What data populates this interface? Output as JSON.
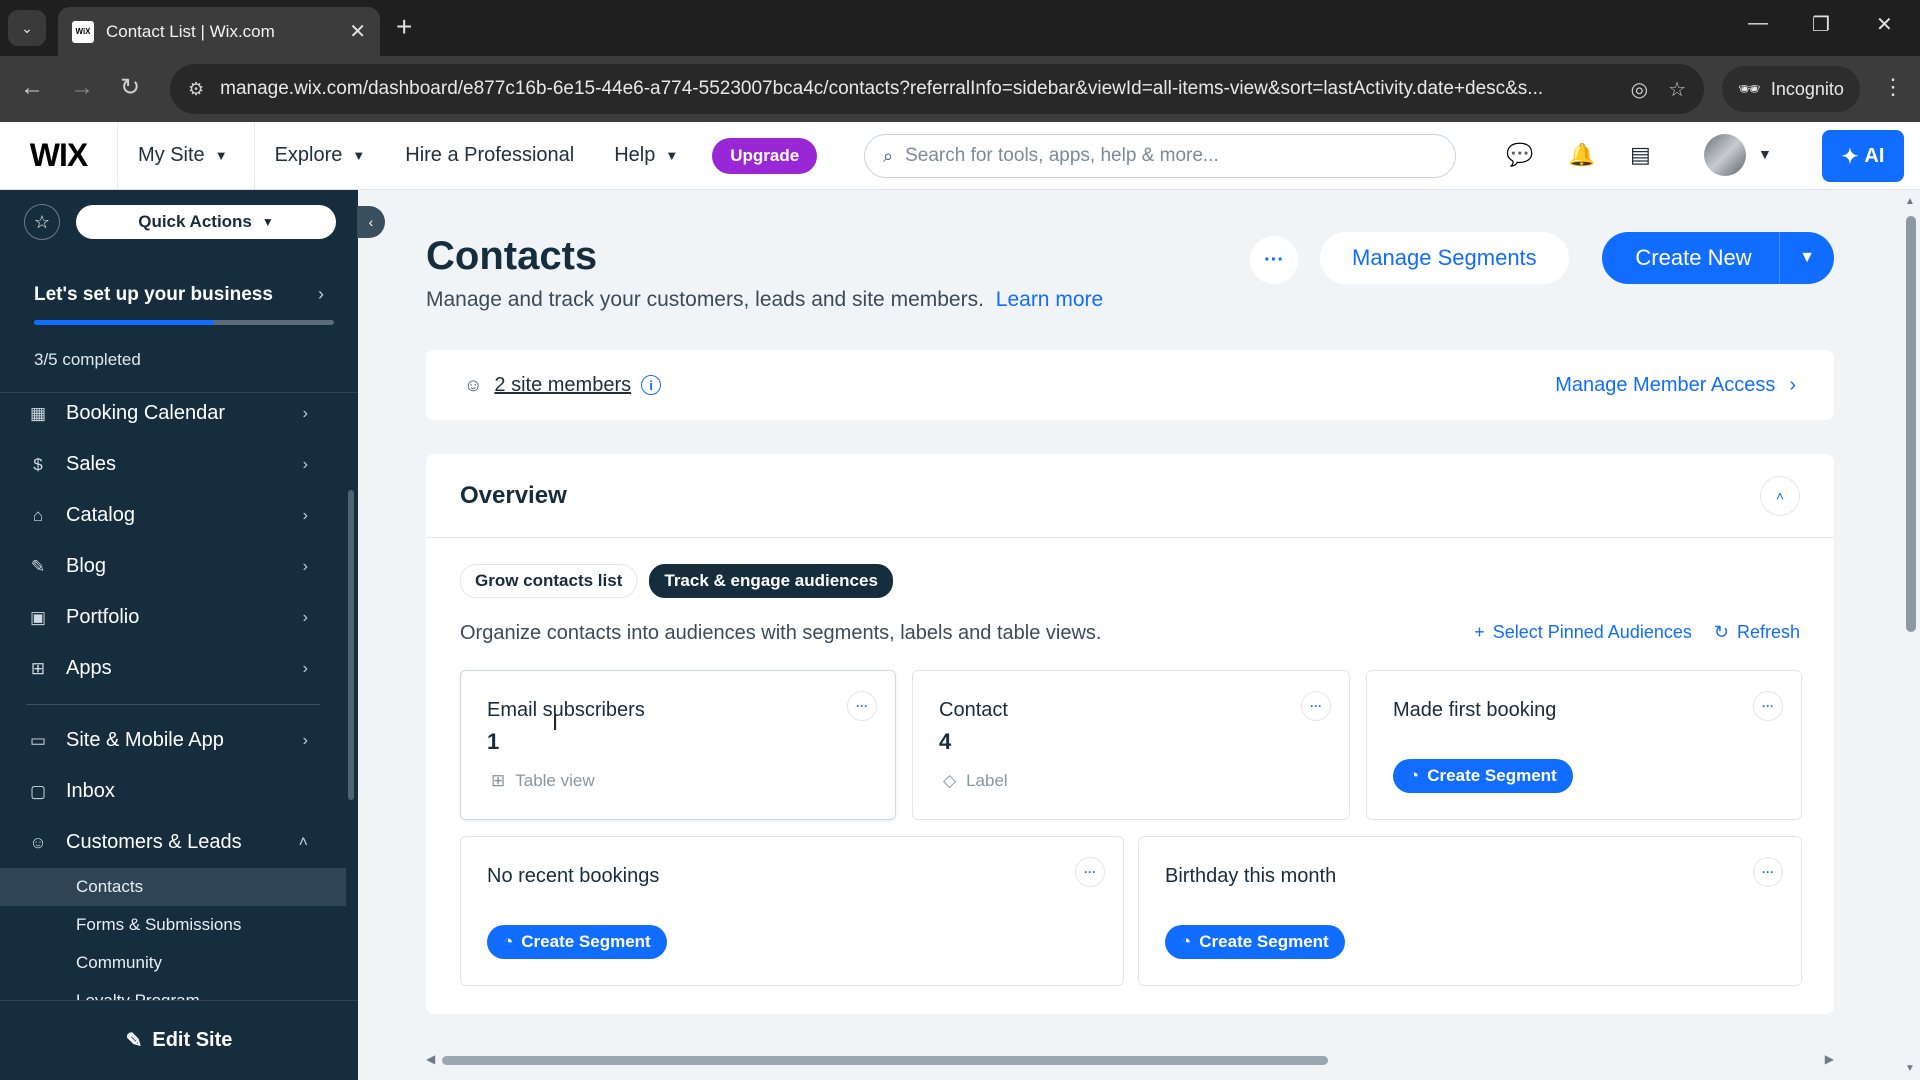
{
  "browser": {
    "tab_title": "Contact List | Wix.com",
    "favicon_text": "WiX",
    "url": "manage.wix.com/dashboard/e877c16b-6e15-44e6-a774-5523007bca4c/contacts?referralInfo=sidebar&viewId=all-items-view&sort=lastActivity.date+desc&s...",
    "incognito_label": "Incognito"
  },
  "topbar": {
    "logo": "WIX",
    "my_site": "My Site",
    "explore": "Explore",
    "hire": "Hire a Professional",
    "help": "Help",
    "upgrade": "Upgrade",
    "search_placeholder": "Search for tools, apps, help & more...",
    "ai_label": "AI"
  },
  "sidebar": {
    "quick_actions": "Quick Actions",
    "setup_title": "Let's set up your business",
    "setup_status": "3/5 completed",
    "setup_progress": 0.6,
    "items": [
      {
        "label": "Booking Calendar",
        "icon": "calendar-icon"
      },
      {
        "label": "Sales",
        "icon": "dollar-icon"
      },
      {
        "label": "Catalog",
        "icon": "tag-icon"
      },
      {
        "label": "Blog",
        "icon": "pen-icon"
      },
      {
        "label": "Portfolio",
        "icon": "portfolio-icon"
      },
      {
        "label": "Apps",
        "icon": "apps-icon"
      }
    ],
    "items2": [
      {
        "label": "Site & Mobile App",
        "icon": "devices-icon"
      },
      {
        "label": "Inbox",
        "icon": "inbox-icon"
      },
      {
        "label": "Customers & Leads",
        "icon": "customers-icon"
      }
    ],
    "sub_items": [
      "Contacts",
      "Forms & Submissions",
      "Community",
      "Loyalty Program"
    ],
    "edit_site": "Edit Site"
  },
  "main": {
    "title": "Contacts",
    "subtitle": "Manage and track your customers, leads and site members.",
    "learn_more": "Learn more",
    "manage_segments": "Manage Segments",
    "create_new": "Create New",
    "members_link": "2 site members",
    "manage_access": "Manage Member Access",
    "overview_title": "Overview",
    "chips": [
      "Grow contacts list",
      "Track & engage audiences"
    ],
    "overview_desc": "Organize contacts into audiences with segments, labels and table views.",
    "select_pinned": "Select Pinned Audiences",
    "refresh": "Refresh",
    "cards": [
      {
        "title": "Email subscribers",
        "count": "1",
        "meta": "Table view"
      },
      {
        "title": "Contact",
        "count": "4",
        "meta": "Label"
      },
      {
        "title": "Made first booking",
        "button": "Create Segment"
      },
      {
        "title": "No recent bookings",
        "button": "Create Segment"
      },
      {
        "title": "Birthday this month",
        "button": "Create Segment"
      }
    ]
  },
  "colors": {
    "accent": "#116dff",
    "sidebar_bg": "#162d3d",
    "upgrade": "#9a27d5"
  }
}
